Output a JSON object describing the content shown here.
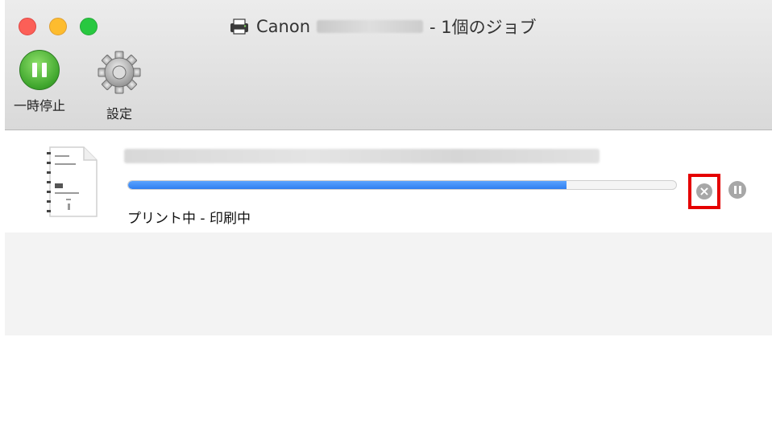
{
  "window": {
    "title_prefix": "Canon",
    "title_suffix": "- 1個のジョブ"
  },
  "toolbar": {
    "pause_label": "一時停止",
    "settings_label": "設定"
  },
  "job": {
    "status_text": "プリント中 - 印刷中",
    "progress_fraction": 0.8
  },
  "colors": {
    "progress_fill": "#2f7ff0",
    "highlight_box": "#e50000",
    "close": "#fc5f57",
    "minimize": "#fdbc2e",
    "maximize": "#28c840"
  },
  "icons": {
    "pause_tool": "pause-icon",
    "settings_tool": "gear-icon",
    "cancel_job": "cancel-icon",
    "pause_job": "pause-icon",
    "document": "document-icon",
    "printer": "printer-icon"
  }
}
